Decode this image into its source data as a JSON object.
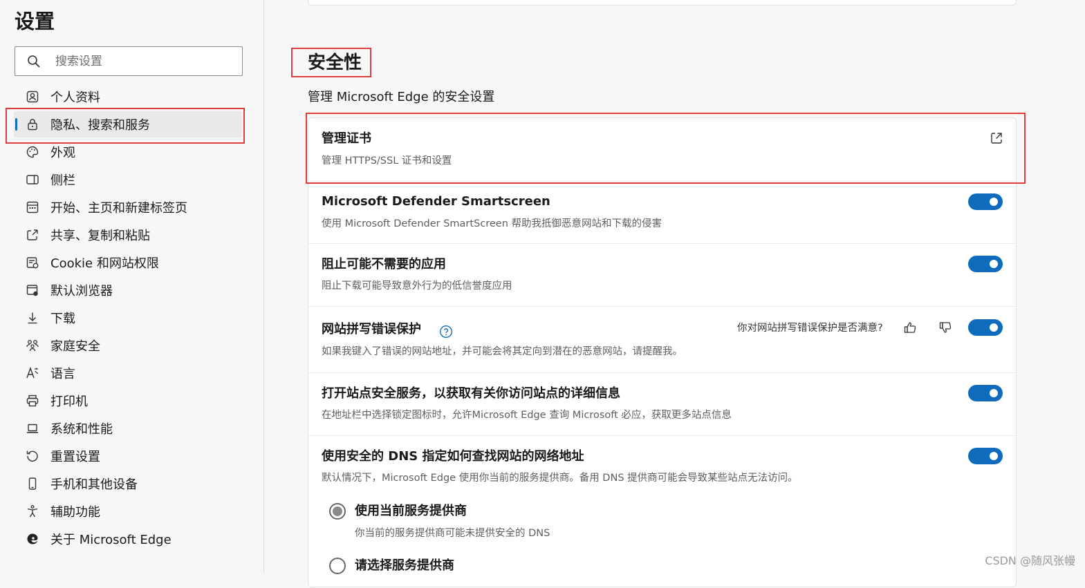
{
  "sidebar": {
    "title": "设置",
    "search_placeholder": "搜索设置",
    "items": [
      {
        "label": "个人资料",
        "icon": "profile-icon"
      },
      {
        "label": "隐私、搜索和服务",
        "icon": "lock-icon",
        "active": true
      },
      {
        "label": "外观",
        "icon": "palette-icon"
      },
      {
        "label": "侧栏",
        "icon": "sidebar-icon"
      },
      {
        "label": "开始、主页和新建标签页",
        "icon": "home-page-icon"
      },
      {
        "label": "共享、复制和粘贴",
        "icon": "share-icon"
      },
      {
        "label": "Cookie 和网站权限",
        "icon": "cookie-permissions-icon"
      },
      {
        "label": "默认浏览器",
        "icon": "default-browser-icon"
      },
      {
        "label": "下载",
        "icon": "download-icon"
      },
      {
        "label": "家庭安全",
        "icon": "family-icon"
      },
      {
        "label": "语言",
        "icon": "language-icon"
      },
      {
        "label": "打印机",
        "icon": "printer-icon"
      },
      {
        "label": "系统和性能",
        "icon": "laptop-icon"
      },
      {
        "label": "重置设置",
        "icon": "reset-icon"
      },
      {
        "label": "手机和其他设备",
        "icon": "phone-icon"
      },
      {
        "label": "辅助功能",
        "icon": "accessibility-icon"
      },
      {
        "label": "关于 Microsoft Edge",
        "icon": "edge-logo-icon"
      }
    ]
  },
  "main": {
    "section_title": "安全性",
    "section_desc": "管理 Microsoft Edge 的安全设置",
    "rows": {
      "certs": {
        "title": "管理证书",
        "desc": "管理 HTTPS/SSL 证书和设置"
      },
      "smartscreen": {
        "title": "Microsoft Defender Smartscreen",
        "desc": "使用 Microsoft Defender SmartScreen 帮助我抵御恶意网站和下载的侵害",
        "on": true
      },
      "pua": {
        "title": "阻止可能不需要的应用",
        "desc": "阻止下载可能导致意外行为的低信誉度应用",
        "on": true
      },
      "typo": {
        "title": "网站拼写错误保护",
        "desc": "如果我键入了错误的网站地址，并可能会将其定向到潜在的恶意网站，请提醒我。",
        "feedback": "你对网站拼写错误保护是否满意?",
        "on": true
      },
      "site_safety": {
        "title": "打开站点安全服务，以获取有关你访问站点的详细信息",
        "desc": "在地址栏中选择锁定图标时，允许Microsoft Edge 查询 Microsoft 必应，获取更多站点信息",
        "on": true
      },
      "dns": {
        "title": "使用安全的 DNS 指定如何查找网站的网络地址",
        "desc": "默认情况下，Microsoft Edge 使用你当前的服务提供商。备用 DNS 提供商可能会导致某些站点无法访问。",
        "on": true,
        "options": [
          {
            "label": "使用当前服务提供商",
            "desc": "你当前的服务提供商可能未提供安全的 DNS",
            "selected": true
          },
          {
            "label": "请选择服务提供商",
            "selected": false
          }
        ]
      }
    }
  },
  "watermark": "CSDN @随风张幔",
  "colors": {
    "accent": "#0f6cbd",
    "highlight_box": "#e03b3b"
  }
}
